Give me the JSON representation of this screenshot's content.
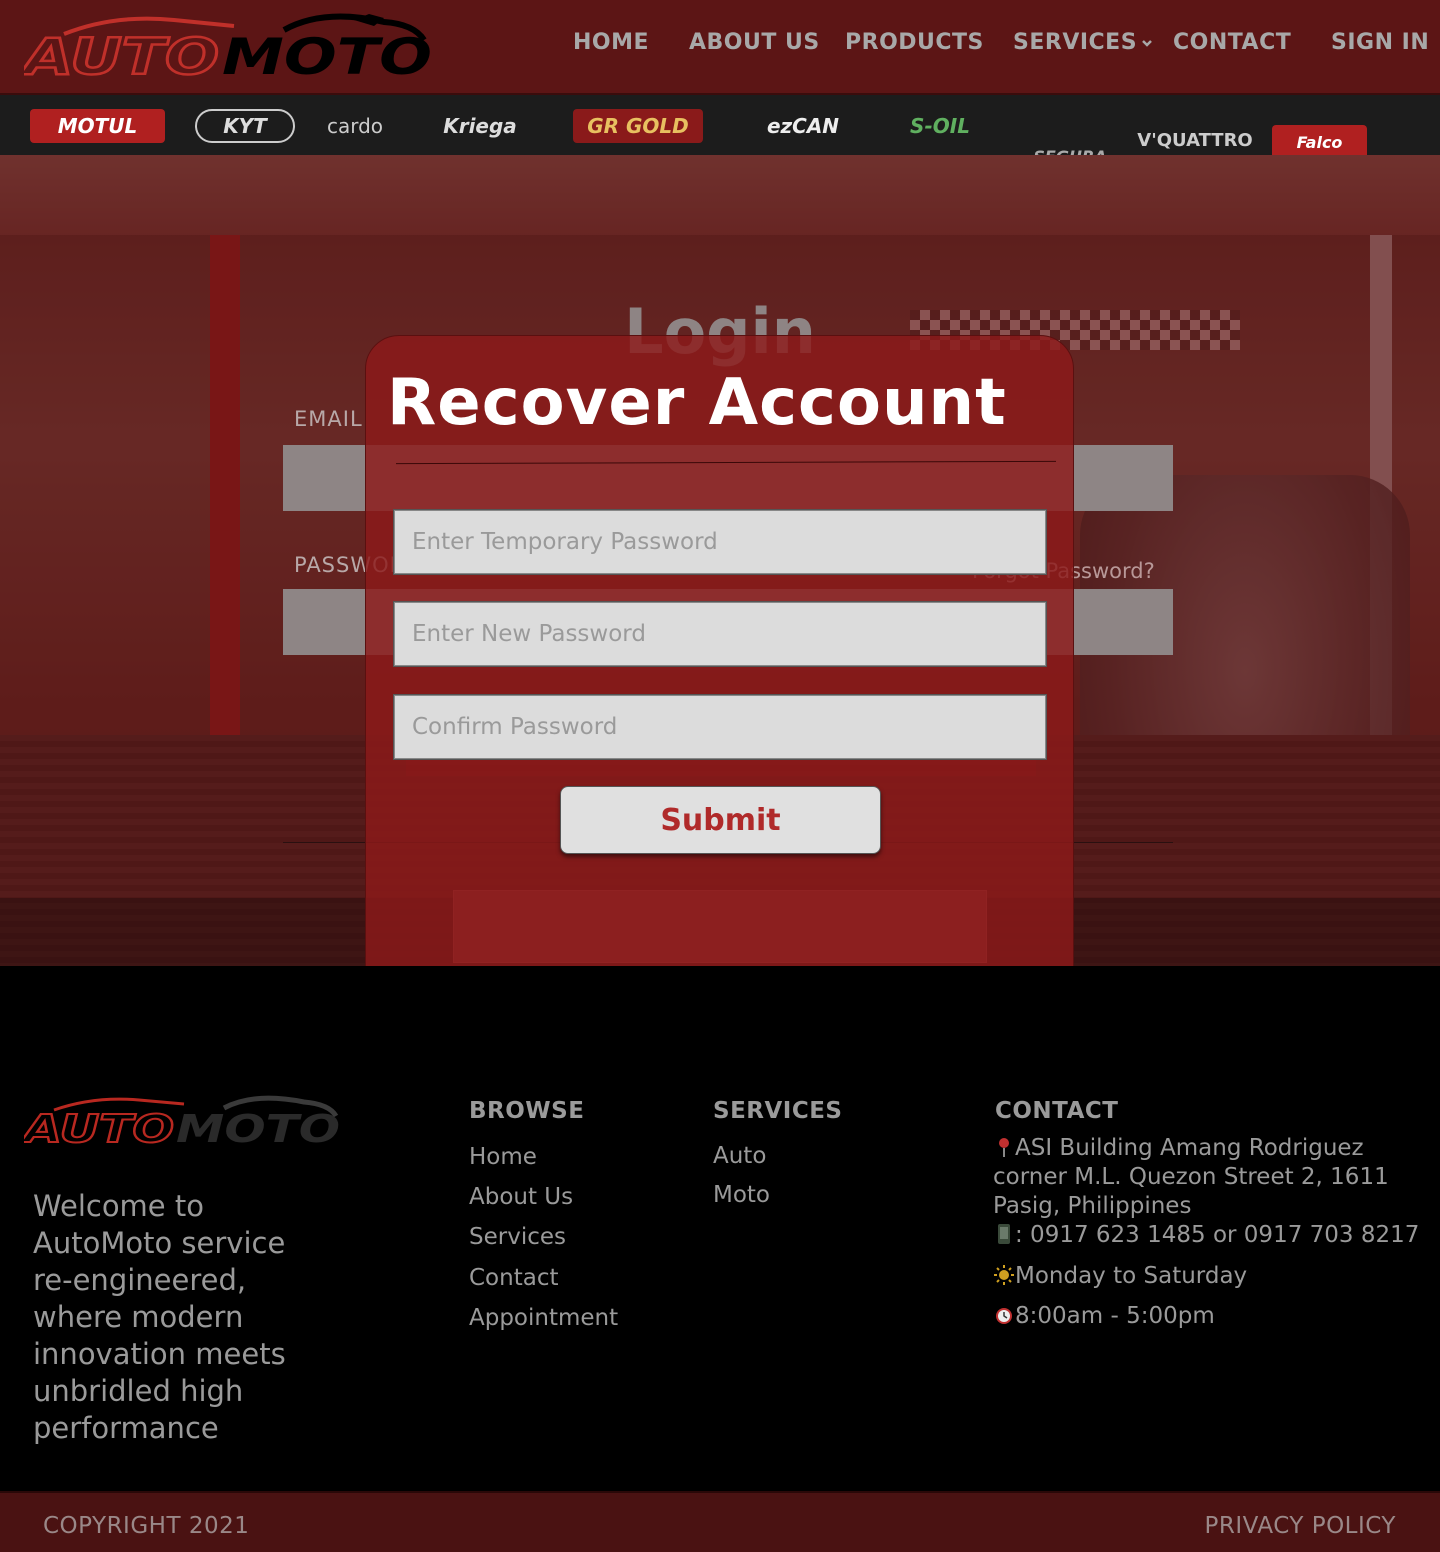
{
  "brand": {
    "logo_text": "AUTOMOTO",
    "logo_colors": {
      "auto": "#c0302a",
      "moto": "#000000"
    }
  },
  "nav": {
    "home": "HOME",
    "about": "ABOUT US",
    "products": "PRODUCTS",
    "services": "SERVICES",
    "contact": "CONTACT",
    "signin": "SIGN IN"
  },
  "hero": {
    "sponsors": [
      "MOTUL",
      "KYT",
      "cardo",
      "Kriega",
      "GR GOLD",
      "ezCAN",
      "S-OIL",
      "SEGURA",
      "V'QUATTRO",
      "Falco"
    ]
  },
  "login": {
    "title": "Login",
    "email_label": "EMAIL",
    "password_label": "PASSWORD",
    "forgot_password": "Forgot Password?"
  },
  "modal": {
    "title": "Recover Account",
    "temp_password_placeholder": "Enter Temporary Password",
    "new_password_placeholder": "Enter New Password",
    "confirm_password_placeholder": "Confirm Password",
    "submit_label": "Submit"
  },
  "footer": {
    "tagline": "Welcome to AutoMoto service re-engineered, where modern innovation meets unbridled high performance",
    "browse": {
      "heading": "BROWSE",
      "links": [
        "Home",
        "About Us",
        "Services",
        "Contact",
        "Appointment"
      ]
    },
    "services": {
      "heading": "SERVICES",
      "links": [
        "Auto",
        "Moto"
      ]
    },
    "contact": {
      "heading": "CONTACT",
      "address": "ASI Building Amang Rodriguez corner M.L. Quezon Street 2, 1611 Pasig, Philippines",
      "phone": ": 0917 623 1485 or 0917 703 8217",
      "days": "Monday to Saturday",
      "hours": "8:00am - 5:00pm"
    },
    "copyright": "COPYRIGHT 2021",
    "privacy": "PRIVACY POLICY"
  },
  "colors": {
    "navbar_bg": "#5c1515",
    "modal_bg": "#8c1a1a",
    "accent_red": "#b02a2a",
    "footer_bg": "#000000",
    "bottom_bar_bg": "#4a1212"
  }
}
